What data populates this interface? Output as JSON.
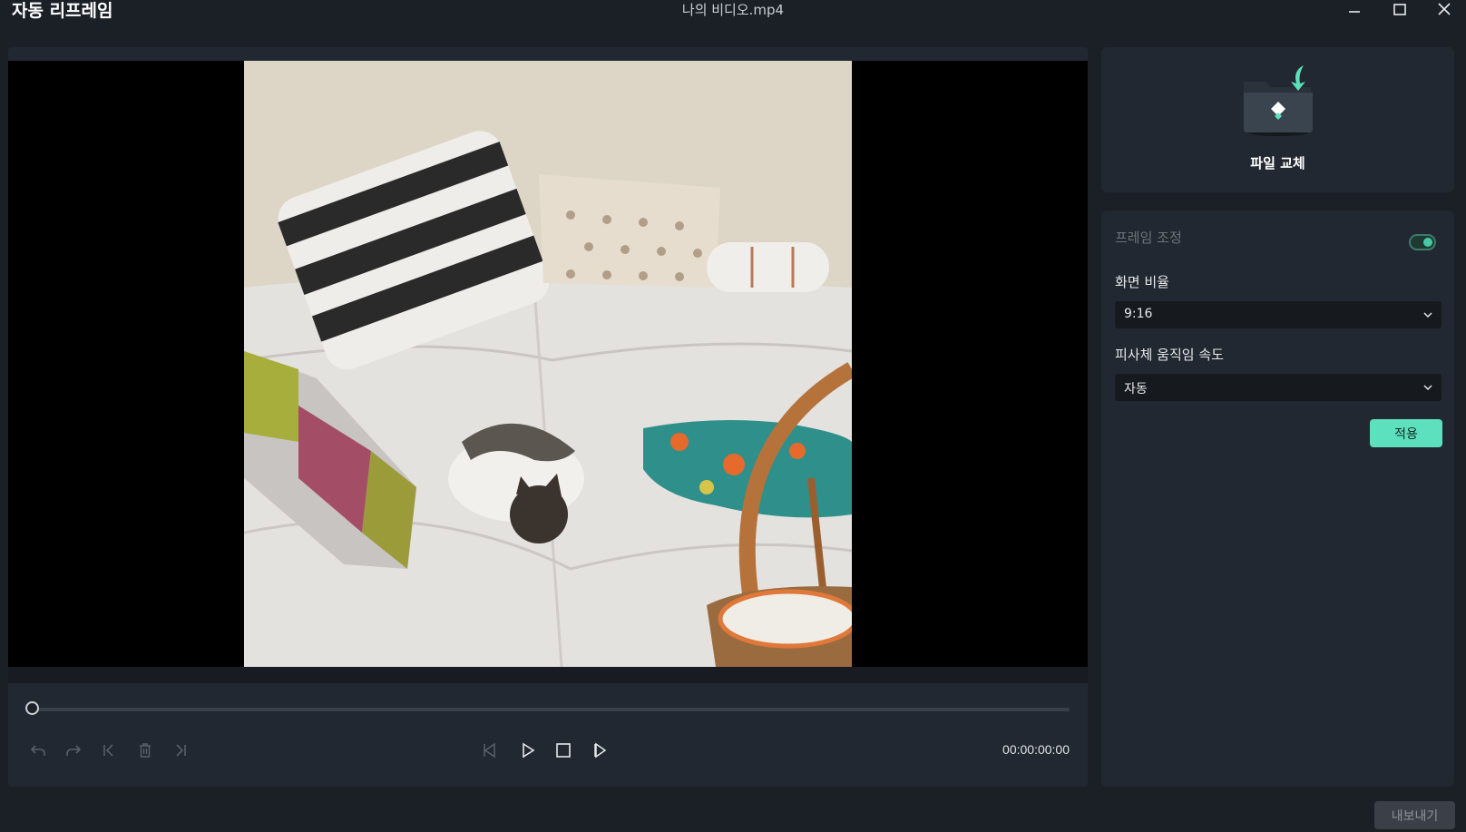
{
  "window": {
    "app_title": "자동 리프레임",
    "file_title": "나의 비디오.mp4",
    "minimize_icon": "minimize-icon",
    "maximize_icon": "maximize-icon",
    "close_icon": "close-icon"
  },
  "player": {
    "timecode": "00:00:00:00",
    "progress": 0,
    "buttons": [
      {
        "name": "undo-button",
        "icon": "undo-icon",
        "enabled": false
      },
      {
        "name": "redo-button",
        "icon": "redo-icon",
        "enabled": false
      },
      {
        "name": "mark-in-button",
        "icon": "mark-in-icon",
        "enabled": false
      },
      {
        "name": "delete-button",
        "icon": "trash-icon",
        "enabled": false
      },
      {
        "name": "mark-out-button",
        "icon": "mark-out-icon",
        "enabled": false
      },
      {
        "name": "prev-frame-button",
        "icon": "prev-frame-icon",
        "enabled": false
      },
      {
        "name": "play-button",
        "icon": "play-icon",
        "enabled": true
      },
      {
        "name": "stop-button",
        "icon": "stop-icon",
        "enabled": true
      },
      {
        "name": "next-frame-button",
        "icon": "next-frame-icon",
        "enabled": true
      }
    ]
  },
  "replace_file": {
    "label": "파일 교체",
    "icon": "replace-file-folder-icon"
  },
  "settings": {
    "frame_adjust_label": "프레임 조정",
    "frame_adjust_enabled": true,
    "aspect_ratio_label": "화면 비율",
    "aspect_ratio_value": "9:16",
    "motion_speed_label": "피사체 움직임 속도",
    "motion_speed_value": "자동",
    "apply_label": "적용"
  },
  "export": {
    "label": "내보내기",
    "enabled": false
  },
  "colors": {
    "accent": "#5ce0bd",
    "background": "#1b2027",
    "panel": "#222831"
  }
}
